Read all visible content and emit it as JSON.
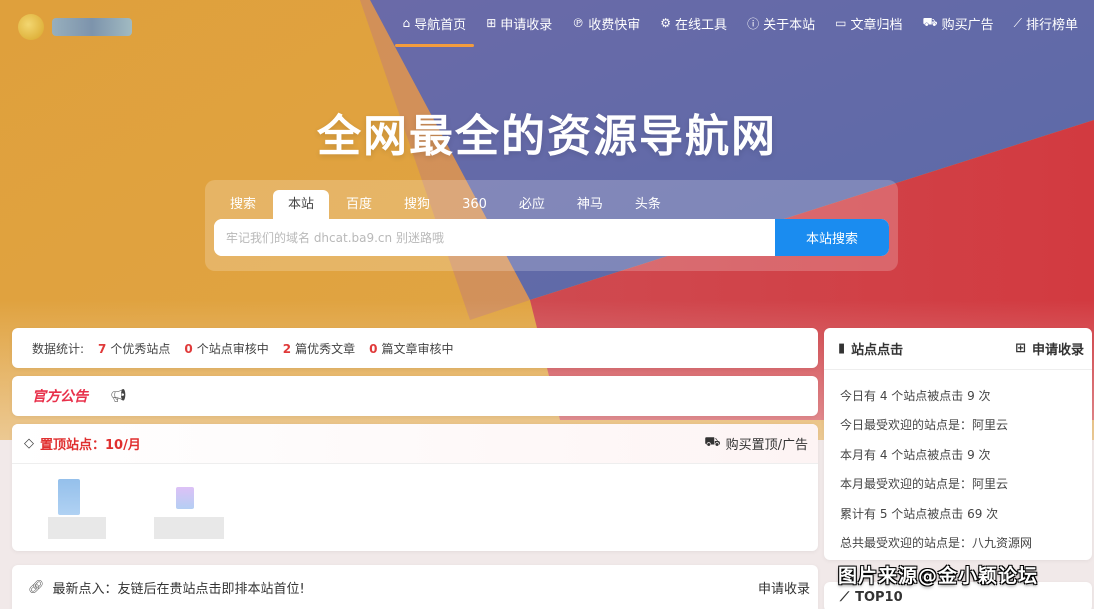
{
  "nav": {
    "items": [
      {
        "icon": "home-icon",
        "glyph": "⌂",
        "label": "导航首页",
        "active": true
      },
      {
        "icon": "plus-square-icon",
        "glyph": "⊞",
        "label": "申请收录"
      },
      {
        "icon": "paypal-icon",
        "glyph": "℗",
        "label": "收费快审"
      },
      {
        "icon": "gears-icon",
        "glyph": "⚙",
        "label": "在线工具"
      },
      {
        "icon": "info-icon",
        "glyph": "ⓘ",
        "label": "关于本站"
      },
      {
        "icon": "folder-open-icon",
        "glyph": "▭",
        "label": "文章归档"
      },
      {
        "icon": "cart-icon",
        "glyph": "⛟",
        "label": "购买广告"
      },
      {
        "icon": "line-chart-icon",
        "glyph": "⟋",
        "label": "排行榜单"
      }
    ]
  },
  "hero": {
    "title": "全网最全的资源导航网"
  },
  "search": {
    "tabs": [
      "搜索",
      "本站",
      "百度",
      "搜狗",
      "360",
      "必应",
      "神马",
      "头条"
    ],
    "active_tab": 1,
    "placeholder": "牢记我们的域名 dhcat.ba9.cn 别迷路哦",
    "button": "本站搜索"
  },
  "stats": {
    "label": "数据统计:",
    "items": [
      {
        "num": "7",
        "text": "个优秀站点"
      },
      {
        "num": "0",
        "text": "个站点审核中"
      },
      {
        "num": "2",
        "text": "篇优秀文章"
      },
      {
        "num": "0",
        "text": "篇文章审核中"
      }
    ]
  },
  "notice": {
    "title": "官方公告",
    "icon": "bullhorn-icon"
  },
  "pinned": {
    "title": "置顶站点：10/月",
    "right_label": "购买置顶/广告"
  },
  "latest": {
    "text": "最新点入：友链后在贵站点击即排本站首位!",
    "right": "申请收录"
  },
  "side": {
    "title": "站点点击",
    "right": "申请收录",
    "lines": [
      "今日有 4 个站点被点击 9 次",
      "今日最受欢迎的站点是：阿里云",
      "本月有 4 个站点被点击 9 次",
      "本月最受欢迎的站点是：阿里云",
      "累计有 5 个站点被点击 69 次",
      "总共最受欢迎的站点是：八九资源网"
    ]
  },
  "top10": {
    "title": "TOP10"
  },
  "watermark": "图片来源@金小颖论坛",
  "colors": {
    "orange": "#e4a13a",
    "purple": "#5b6aa6",
    "red": "#d43f45",
    "accent_blue": "#1a8cf0",
    "highlight_red": "#e03a3a"
  }
}
